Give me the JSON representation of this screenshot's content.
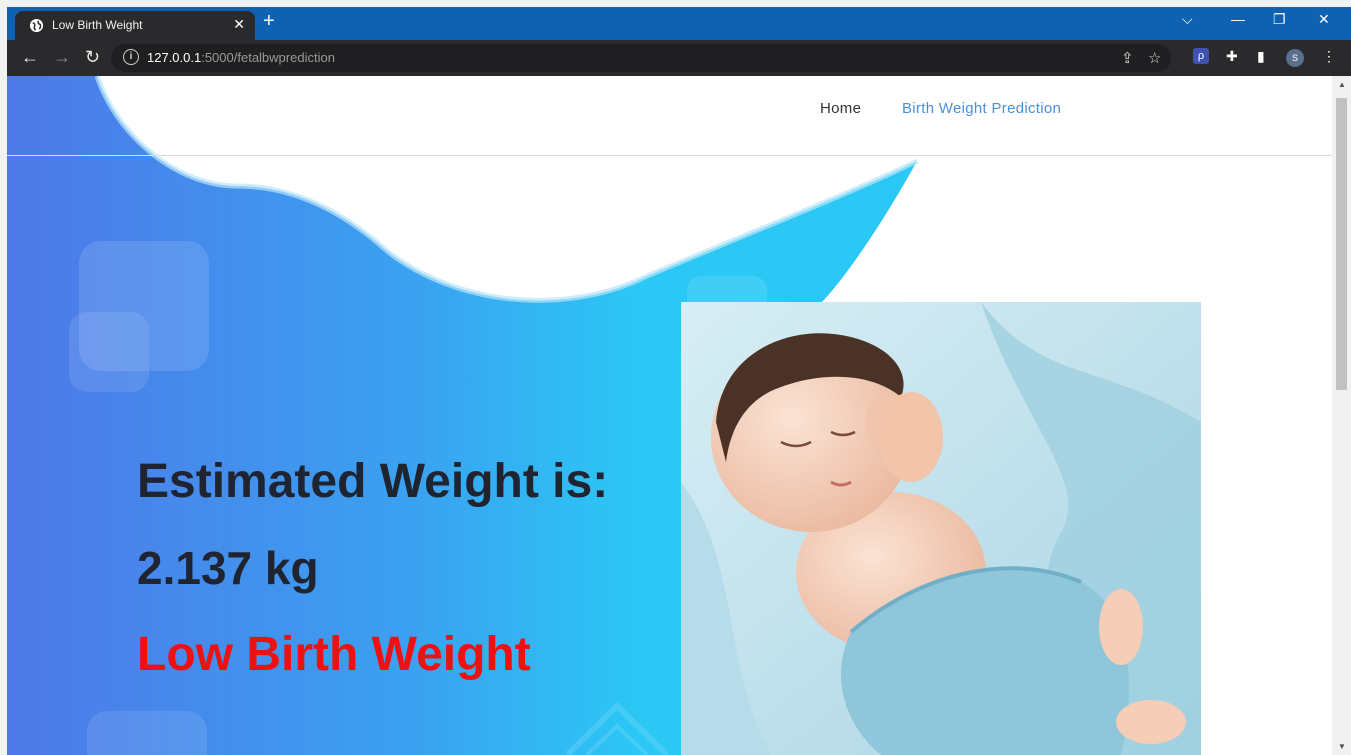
{
  "browser": {
    "tab_title": "Low Birth Weight",
    "tab_close": "✕",
    "new_tab": "+",
    "url_host": "127.0.0.1",
    "url_path": ":5000/fetalbwprediction",
    "avatar_initial": "S",
    "profile_color": "#5a6f8c"
  },
  "nav": {
    "home": "Home",
    "prediction": "Birth Weight Prediction"
  },
  "result": {
    "heading": "Estimated Weight is:",
    "weight": "2.137 kg",
    "classification": "Low Birth Weight"
  },
  "colors": {
    "classification": "#ee1111",
    "nav_active": "#4a90d9",
    "gradient_start": "#4e78e8",
    "gradient_end": "#2bc8f5"
  },
  "icons": {
    "photo": "sleeping-baby-image"
  }
}
